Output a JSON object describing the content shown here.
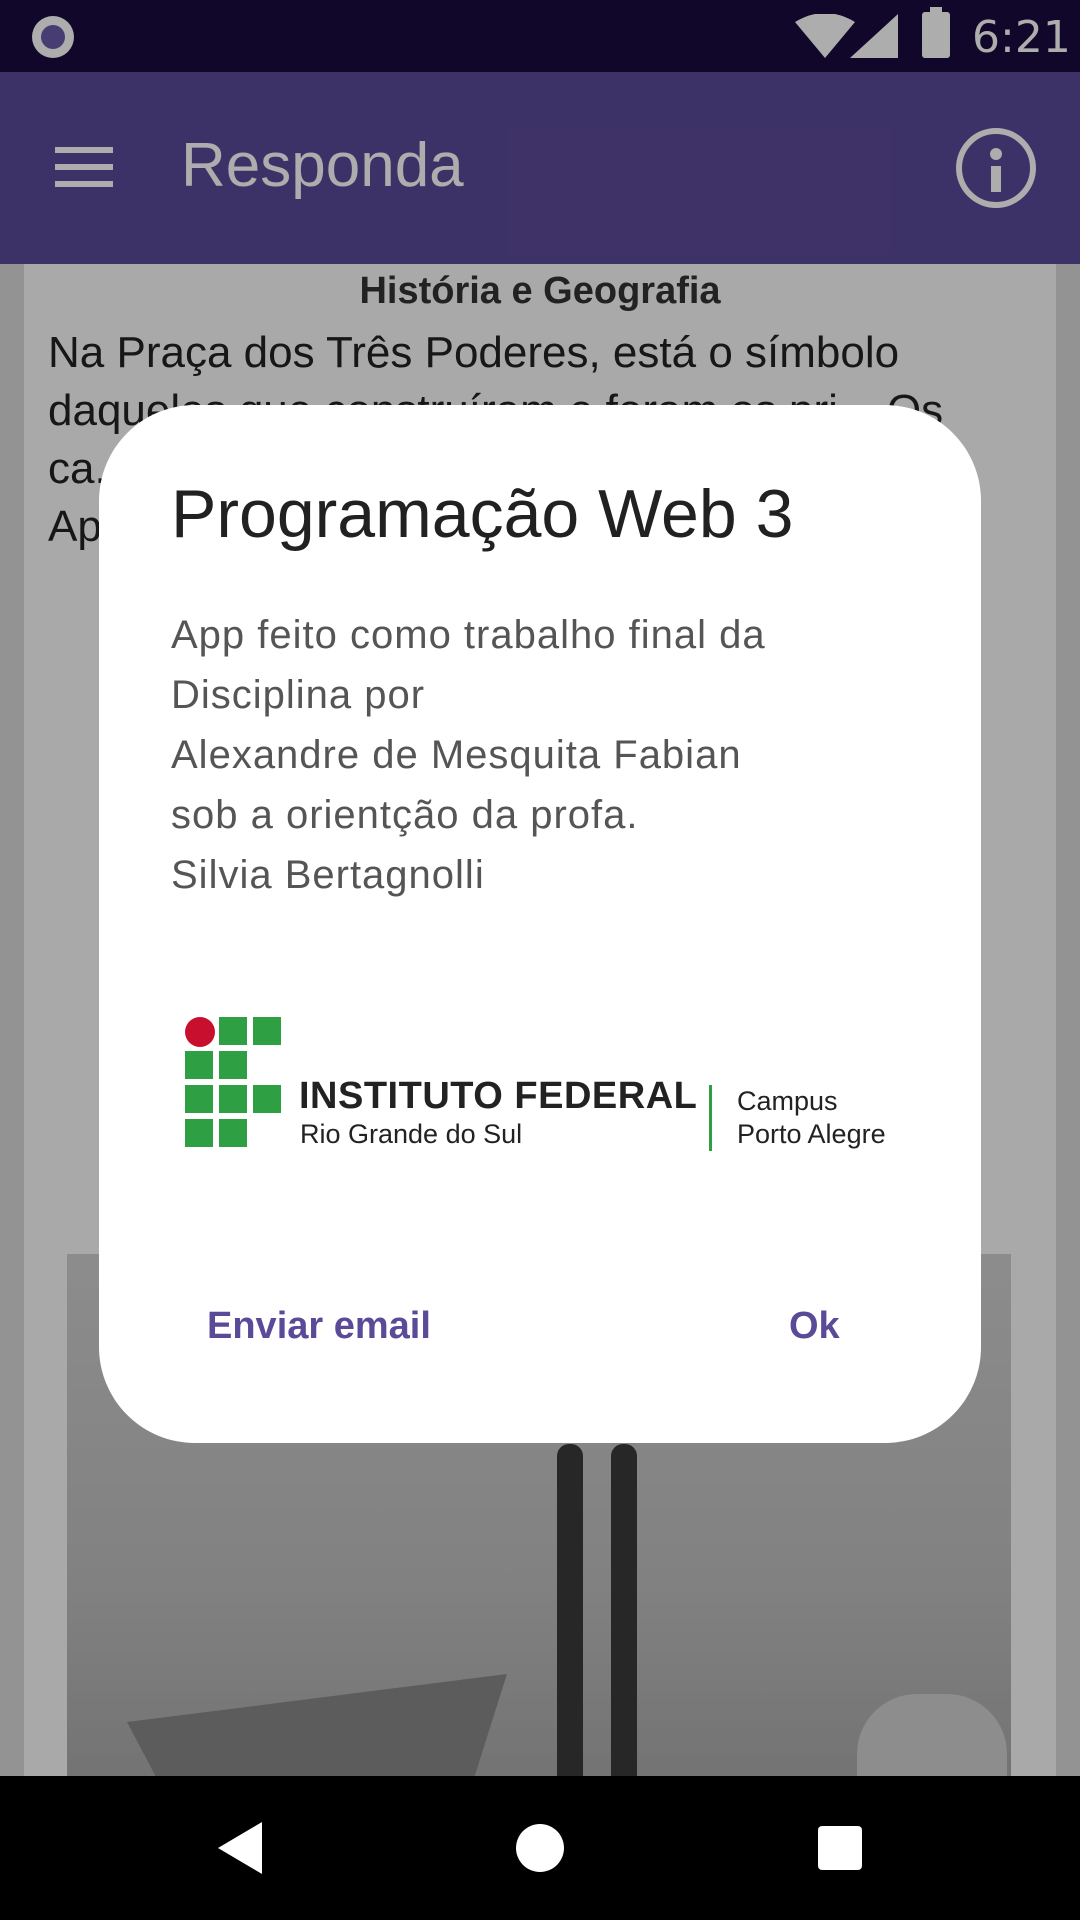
{
  "status_bar": {
    "time": "6:21"
  },
  "app_bar": {
    "title": "Responda"
  },
  "content": {
    "subject": "História e Geografia",
    "question_text": "Na Praça dos Três Poderes, está o símbolo daqueles que construíram e foram os pri... Os ca... to... de de... m co... a c... 21 sir Di... o em Ap... s tra mo"
  },
  "dialog": {
    "title": "Programação Web 3",
    "message_lines": [
      "App feito como trabalho final da",
      "Disciplina por",
      "Alexandre de Mesquita Fabian",
      "sob a orientção da profa.",
      "Silvia Bertagnolli"
    ],
    "logo": {
      "name": "INSTITUTO FEDERAL",
      "subtitle": "Rio Grande do Sul",
      "campus_line1": "Campus",
      "campus_line2": "Porto Alegre"
    },
    "buttons": {
      "email": "Enviar email",
      "ok": "Ok"
    }
  },
  "colors": {
    "primary": "#5b4a98",
    "status_bar": "#1a0b3f",
    "logo_green": "#2ea043",
    "logo_red": "#c8102e"
  }
}
